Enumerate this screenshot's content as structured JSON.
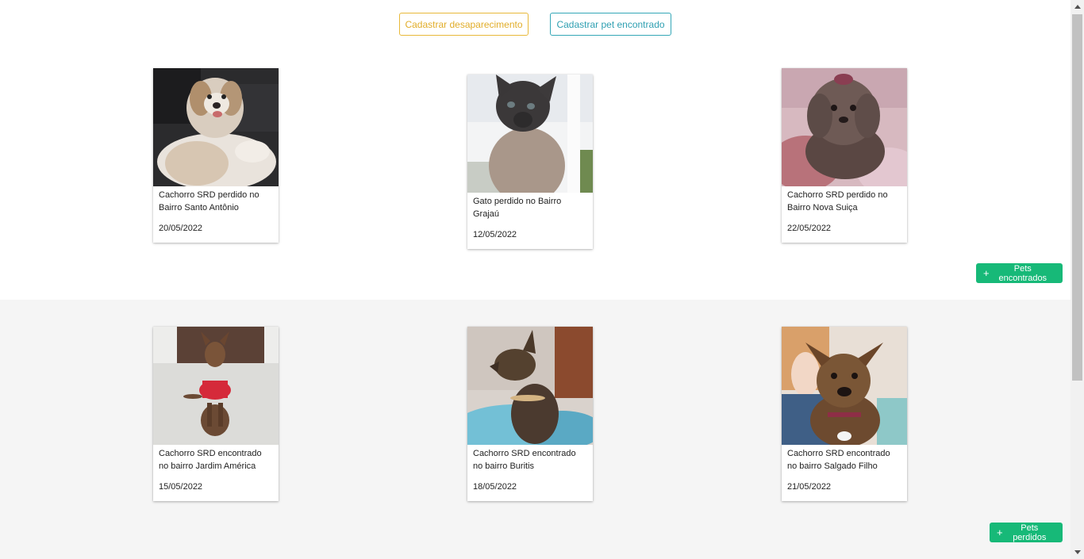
{
  "actions": {
    "register_lost": "Cadastrar desaparecimento",
    "register_found": "Cadastrar pet encontrado"
  },
  "lost_pets": [
    {
      "title": "Cachorro SRD perdido no Bairro Santo Antônio",
      "date": "20/05/2022"
    },
    {
      "title": "Gato perdido no Bairro Grajaú",
      "date": "12/05/2022"
    },
    {
      "title": "Cachorro SRD perdido no Bairro Nova Suiça",
      "date": "22/05/2022"
    }
  ],
  "found_pets": [
    {
      "title": "Cachorro SRD encontrado no bairro Jardim América",
      "date": "15/05/2022"
    },
    {
      "title": "Cachorro SRD encontrado no bairro Buritis",
      "date": "18/05/2022"
    },
    {
      "title": "Cachorro SRD encontrado no bairro Salgado Filho",
      "date": "21/05/2022"
    }
  ],
  "more_buttons": {
    "found": "Pets encontrados",
    "lost": "Pets perdidos",
    "plus": "+"
  },
  "colors": {
    "lost_accent": "#e1ad29",
    "found_accent": "#2e9fb1",
    "green_button": "#17b978"
  }
}
